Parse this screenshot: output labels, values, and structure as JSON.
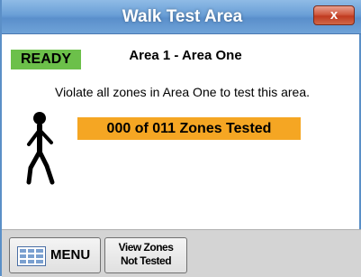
{
  "window": {
    "title": "Walk Test Area",
    "close_label": "x"
  },
  "status": {
    "badge": "READY",
    "badge_color": "#6cc04a"
  },
  "area": {
    "title": "Area 1 - Area One"
  },
  "instruction": "Violate all zones in Area One to test this area.",
  "progress": {
    "text": "000 of 011 Zones Tested",
    "tested": 0,
    "total": 11,
    "color": "#f5a623"
  },
  "icons": {
    "walker": "walking-person-icon",
    "menu": "keypad-menu-icon"
  },
  "bottom_bar": {
    "menu_label": "MENU",
    "view_zones_line1": "View Zones",
    "view_zones_line2": "Not Tested"
  }
}
